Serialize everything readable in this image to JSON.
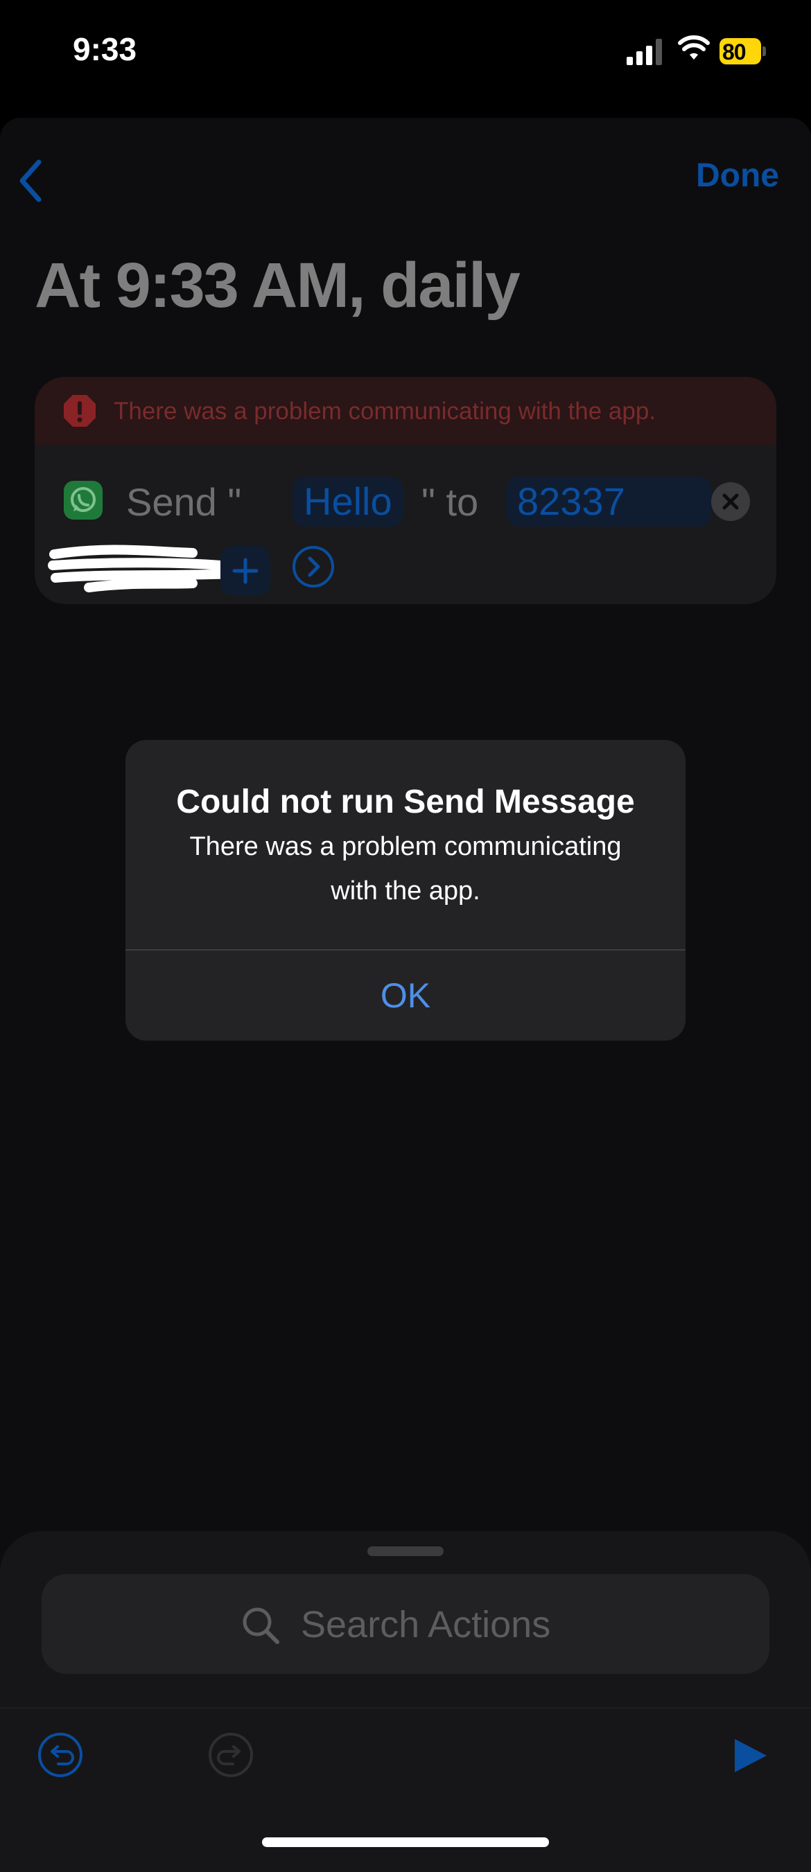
{
  "status_bar": {
    "time": "9:33",
    "battery": "80"
  },
  "nav": {
    "done_label": "Done"
  },
  "automation": {
    "title": "At 9:33 AM, daily"
  },
  "action_card": {
    "error_text": "There was a problem communicating with the app.",
    "send_label": "Send \"",
    "message_token": "Hello",
    "to_label": "\" to",
    "recipient_token": "82337"
  },
  "alert": {
    "title": "Could not run Send Message",
    "message": "There was a problem communicating with the app.",
    "ok_label": "OK"
  },
  "bottom": {
    "search_placeholder": "Search Actions"
  },
  "colors": {
    "accent": "#0a4ea0",
    "alert_button": "#4f8fe6",
    "error": "#d33a3a",
    "battery": "#ffd60a"
  }
}
